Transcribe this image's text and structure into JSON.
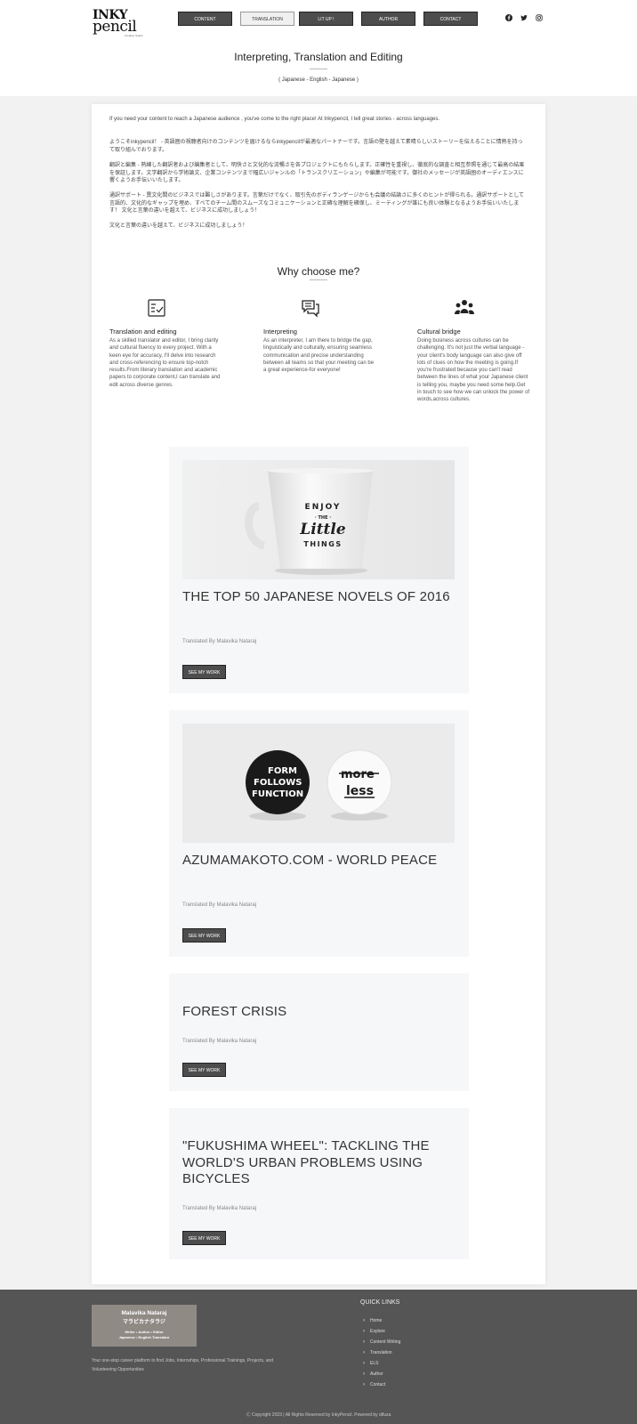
{
  "header": {
    "logo": {
      "line1": "INKY",
      "line2": "pencil",
      "tagline": "Creative Studio"
    },
    "nav": [
      {
        "label": "CONTENT",
        "active": false
      },
      {
        "label": "TRANSLATION",
        "active": true
      },
      {
        "label": "LIT UP !",
        "active": false
      },
      {
        "label": "AUTHOR",
        "active": false
      },
      {
        "label": "CONTACT",
        "active": false
      }
    ],
    "socials": [
      "facebook-icon",
      "twitter-icon",
      "instagram-icon"
    ]
  },
  "page": {
    "title": "Interpreting, Translation and Editing",
    "subtitle": "( Japanese - English - Japanese )"
  },
  "intro": {
    "english": "If you need your content to reach a Japanese audience , you've come to the right place! At Inkypencil, I tell great stories - across languages.",
    "japanese": [
      "ようこそinkypencil！ - 英語圏の視聴者向けのコンテンツを届けるならinkypencilが最適なパートナーです。言語の壁を越えて素晴らしいストーリーを伝えることに情熱を持って取り組んでおります。",
      "翻訳と編集 - 熟練した翻訳者および編集者として、明快さと文化的な流暢さを各プロジェクトにもたらします。正確性を重視し、徹底的な調査と相互参照を通じて最高の結果を保証します。文学翻訳から学術論文、企業コンテンツまで幅広いジャンルの「トランスクリエーション」や編集が可能です。御社のメッセージが英語圏のオーディエンスに響くようお手伝いいたします。",
      "通訳サポート - 異文化間のビジネスでは難しさがあります。言葉だけでなく、取引先のボディランゲージからも会議の結論さに多くのヒントが得られる。通訳サポートとして言語的、文化的なギャップを埋め、すべてのチーム間のスムーズなコミュニケーションと正確な理解を確保し、ミーティングが誰にも良い体験となるようお手伝いいたします！ 文化と言葉の違いを越えて、ビジネスに成功しましょう！",
      "文化と言葉の違いを越えて、ビジネスに成功しましょう！"
    ]
  },
  "why": {
    "title": "Why choose me?",
    "features": [
      {
        "icon": "checklist-icon",
        "title": "Translation and editing",
        "text": "As a skilled translator and editor, I bring clarity and cultural fluency to every project. With a keen eye for accuracy, I'll delve into research and cross-referencing to ensure top-notch results.From literary translation and academic papers to corporate content,I can translate and edit across diverse genres."
      },
      {
        "icon": "chat-bubbles-icon",
        "title": "Interpreting",
        "text": "As an interpreter, I am there to bridge the gap, linguistically and culturally, ensuring seamless communication and precise understanding between all teams so that your meeting can be a great experience-for everyone!"
      },
      {
        "icon": "people-group-icon",
        "title": "Cultural bridge",
        "text": "Doing business across cultures can be challenging. It's not just the verbal language - your client's body language can also give off lots of clues on how the meeting is going.If you're frustrated because you can't read between the lines of what your Japanese client is telling you, maybe you need some help.Get in touch to see how we can unlock the power of words,across cultures."
      }
    ]
  },
  "posts": [
    {
      "title": "THE TOP 50 JAPANESE NOVELS OF 2016",
      "byline": "Translated By Malavika Nataraj",
      "button": "SEE MY WORK",
      "image": "mug",
      "image_text": [
        "ENJOY",
        "· THE ·",
        "Little",
        "THINGS"
      ]
    },
    {
      "title": "AZUMAMAKOTO.COM - WORLD PEACE",
      "byline": "Translated By Malavika Nataraj",
      "button": "SEE MY WORK",
      "image": "badges",
      "image_text": [
        "FORM",
        "FOLLOWS",
        "FUNCTION",
        "more",
        "less"
      ]
    },
    {
      "title": "FOREST CRISIS",
      "byline": "Translated By Malavika Nataraj",
      "button": "SEE MY WORK"
    },
    {
      "title": "\"FUKUSHIMA WHEEL\": TACKLING THE WORLD'S URBAN PROBLEMS USING BICYCLES",
      "byline": "Translated By Malavika Nataraj",
      "button": "SEE MY WORK"
    }
  ],
  "footer": {
    "card": {
      "name_en": "Malavika Nataraj",
      "name_jp": "マラビカナタラジ",
      "roles": "Writer • Author • Editor",
      "languages": "Japanese • English Translator"
    },
    "tagline": "Your one-stop career platform to find Jobs, Internships, Professional Trainings, Projects, and Volunteering Opportunities",
    "quick_links_title": "QUICK LINKS",
    "quick_links": [
      "Home",
      "Explore",
      "Content Writing",
      "Translation",
      "ELS",
      "Author",
      "Contact"
    ],
    "copyright": "Ⓒ Copyright 2023 | All Rights Reserved by InkyPencil. Powered by difuza"
  }
}
